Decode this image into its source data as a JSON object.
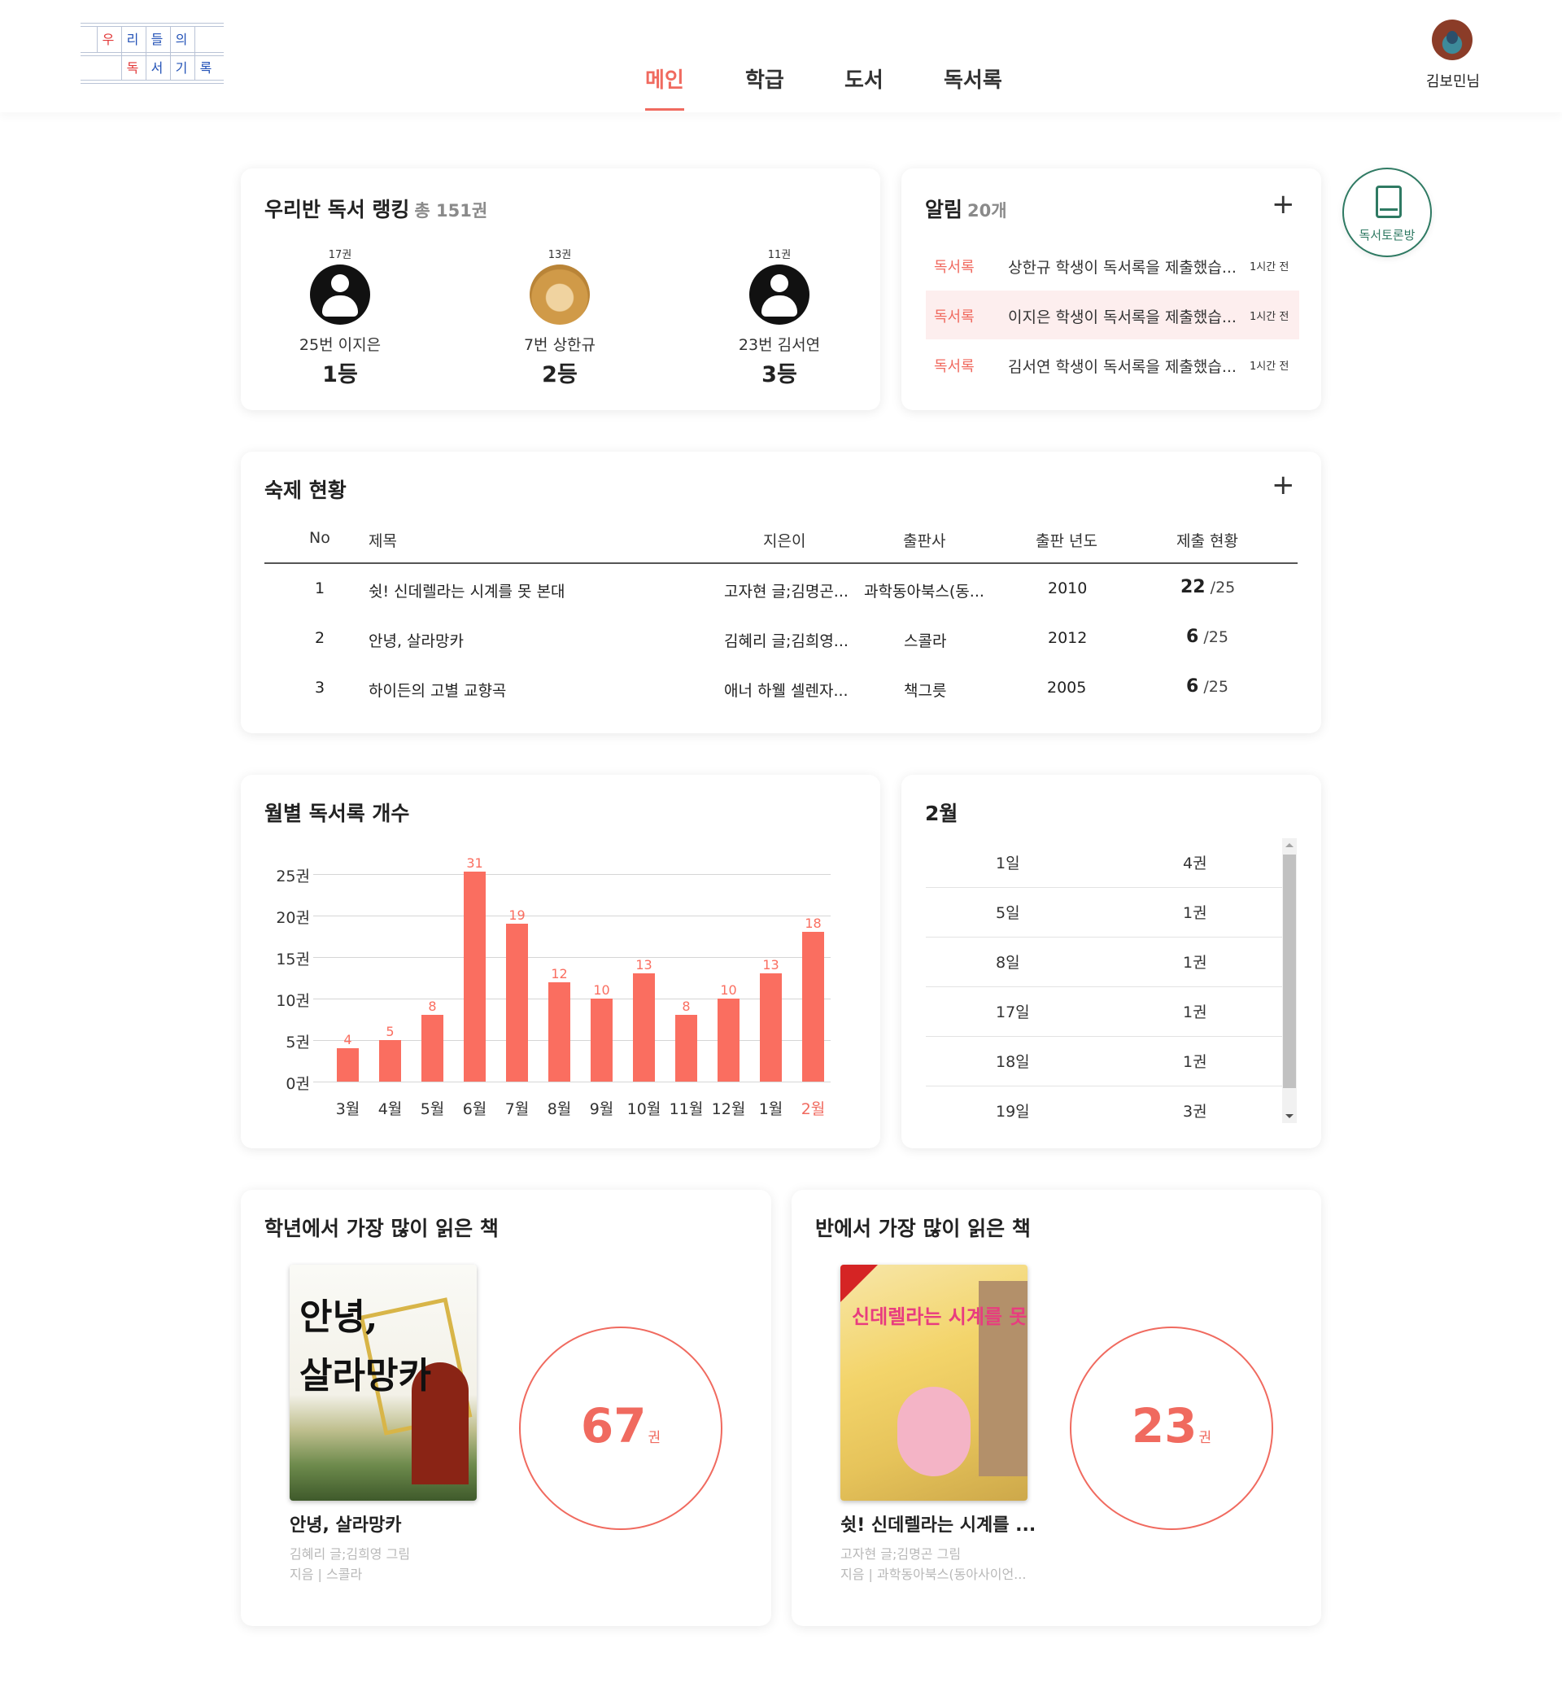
{
  "logo": {
    "row1": [
      "우",
      "리",
      "들",
      "의"
    ],
    "row2": [
      "독",
      "서",
      "기",
      "록"
    ]
  },
  "nav": {
    "items": [
      "메인",
      "학급",
      "도서",
      "독서록"
    ],
    "active": "메인"
  },
  "user": {
    "name": "김보민님"
  },
  "discussion_button": {
    "label": "독서토론방",
    "icon": "book-icon"
  },
  "ranking": {
    "title": "우리반 독서 랭킹",
    "total": "총 151권",
    "entries": [
      {
        "count": "17권",
        "name": "25번 이지은",
        "place": "1등",
        "avatar": "person-icon"
      },
      {
        "count": "13권",
        "name": "7번 상한규",
        "place": "2등",
        "avatar": "dog-photo"
      },
      {
        "count": "11권",
        "name": "23번 김서연",
        "place": "3등",
        "avatar": "person-icon"
      }
    ]
  },
  "notices": {
    "title": "알림",
    "count": "20개",
    "items": [
      {
        "tag": "독서록",
        "message": "상한규 학생이 독서록을 제출했습...",
        "time": "1시간 전"
      },
      {
        "tag": "독서록",
        "message": "이지은 학생이 독서록을 제출했습...",
        "time": "1시간 전"
      },
      {
        "tag": "독서록",
        "message": "김서연 학생이 독서록을 제출했습...",
        "time": "1시간 전"
      }
    ]
  },
  "homework": {
    "title": "숙제 현황",
    "columns": [
      "No",
      "제목",
      "지은이",
      "출판사",
      "출판 년도",
      "제출 현황"
    ],
    "rows": [
      {
        "no": "1",
        "title": "쉿! 신데렐라는 시계를 못 본대",
        "author": "고자현 글;김명곤...",
        "publisher": "과학동아북스(동...",
        "year": "2010",
        "submitted": "22",
        "total": "/25"
      },
      {
        "no": "2",
        "title": "안녕, 살라망카",
        "author": "김혜리 글;김희영...",
        "publisher": "스콜라",
        "year": "2012",
        "submitted": "6",
        "total": "/25"
      },
      {
        "no": "3",
        "title": "하이든의 고별 교향곡",
        "author": "애너 하웰 셀렌자...",
        "publisher": "책그릇",
        "year": "2005",
        "submitted": "6",
        "total": "/25"
      }
    ]
  },
  "chart_data": {
    "type": "bar",
    "title": "월별 독서록 개수",
    "categories": [
      "3월",
      "4월",
      "5월",
      "6월",
      "7월",
      "8월",
      "9월",
      "10월",
      "11월",
      "12월",
      "1월",
      "2월"
    ],
    "values": [
      4,
      5,
      8,
      31,
      19,
      12,
      10,
      13,
      8,
      10,
      13,
      18
    ],
    "y_ticks": [
      "25권",
      "20권",
      "15권",
      "10권",
      "5권",
      "0권"
    ],
    "ylim": [
      0,
      25
    ],
    "highlight_category": "2월",
    "bar_color": "#fa6e60",
    "grid": true
  },
  "daily": {
    "title": "2월",
    "rows": [
      {
        "day": "1일",
        "count": "4권"
      },
      {
        "day": "5일",
        "count": "1권"
      },
      {
        "day": "8일",
        "count": "1권"
      },
      {
        "day": "17일",
        "count": "1권"
      },
      {
        "day": "18일",
        "count": "1권"
      },
      {
        "day": "19일",
        "count": "3권"
      }
    ]
  },
  "grade_top": {
    "title": "학년에서 가장 많이 읽은 책",
    "book_title": "안녕, 살라망카",
    "authors": "김혜리 글;김희영 그림",
    "publisher": "지음 | 스콜라",
    "count": "67",
    "unit": "권",
    "cover_text": [
      "안녕,",
      "살라망카"
    ]
  },
  "class_top": {
    "title": "반에서 가장 많이 읽은 책",
    "book_title": "쉿! 신데렐라는 시계를 ...",
    "authors": "고자현 글;김명곤 그림",
    "publisher": "지음 | 과학동아북스(동아사이언...",
    "count": "23",
    "unit": "권",
    "cover_text": "신데렐라는 시계를 못 본대"
  },
  "colors": {
    "accent": "#f06a5f",
    "discussion": "#2f7a63",
    "highlight_row": "#fdeeee"
  }
}
